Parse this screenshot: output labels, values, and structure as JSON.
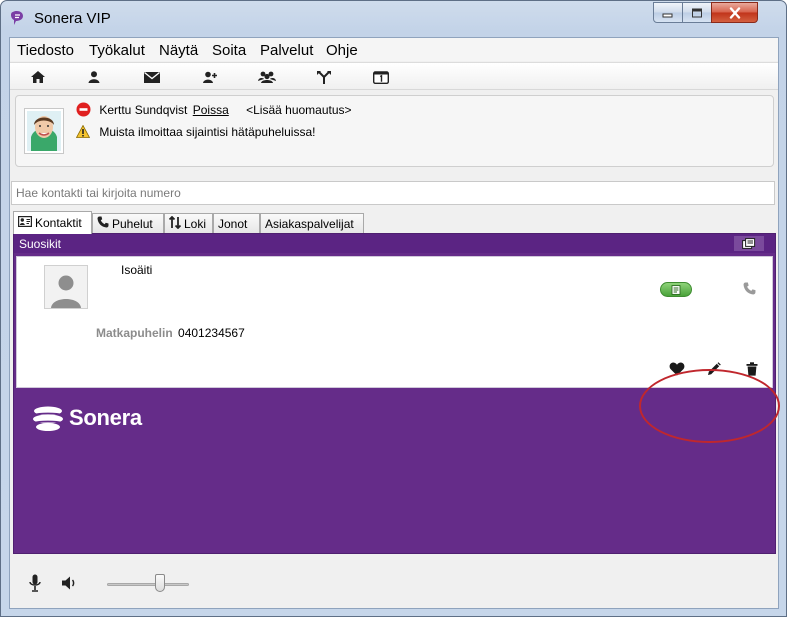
{
  "window": {
    "title": "Sonera VIP"
  },
  "menu": [
    "Tiedosto",
    "Työkalut",
    "Näytä",
    "Soita",
    "Palvelut",
    "Ohje"
  ],
  "toolbar": {
    "icons": [
      "home-icon",
      "person-icon",
      "mail-icon",
      "add-contact-icon",
      "group-icon",
      "transfer-icon",
      "calendar-icon"
    ]
  },
  "status": {
    "user_name": "Kerttu Sundqvist",
    "presence": "Poissa",
    "note_placeholder": "<Lisää huomautus>",
    "warning": "Muista ilmoittaa sijaintisi hätäpuheluissa!",
    "presence_color": "#e02020"
  },
  "search": {
    "placeholder": "Hae kontakti tai kirjoita numero"
  },
  "tabs": [
    {
      "label": "Kontaktit",
      "icon": "contact-card-icon",
      "active": true
    },
    {
      "label": "Puhelut",
      "icon": "phone-icon"
    },
    {
      "label": "Loki",
      "icon": "log-icon"
    },
    {
      "label": "Jonot"
    },
    {
      "label": "Asiakaspalvelijat"
    }
  ],
  "favorites": {
    "header": "Suosikit",
    "contact": {
      "name": "Isoäiti",
      "phone_label": "Matkapuhelin",
      "phone_number": "0401234567"
    }
  },
  "brand": {
    "name": "Sonera",
    "color": "#652c89"
  },
  "audio": {
    "volume_level": 0.6
  }
}
